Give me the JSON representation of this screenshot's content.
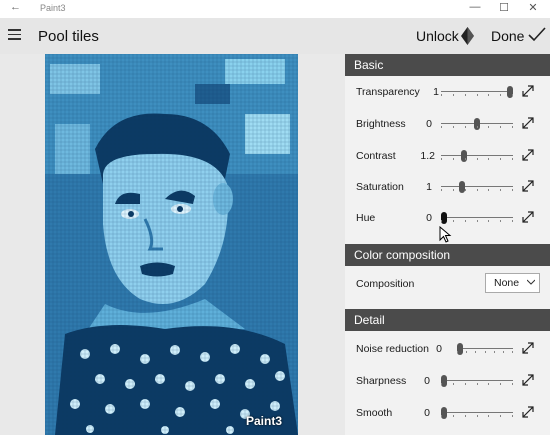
{
  "window": {
    "title": "Paint3",
    "back_glyph": "←",
    "minimize": "—",
    "maximize": "☐",
    "close": "✕"
  },
  "header": {
    "page_title": "Pool tiles",
    "unlock_label": "Unlock",
    "done_label": "Done"
  },
  "canvas": {
    "watermark": "Paint3"
  },
  "panel": {
    "basic": {
      "title": "Basic",
      "rows": [
        {
          "label": "Transparency",
          "value": "1",
          "level": 1.0
        },
        {
          "label": "Brightness",
          "value": "0",
          "level": 0.5
        },
        {
          "label": "Contrast",
          "value": "1.2",
          "level": 0.3
        },
        {
          "label": "Saturation",
          "value": "1",
          "level": 0.27
        },
        {
          "label": "Hue",
          "value": "0",
          "level": 0.0
        }
      ]
    },
    "color_composition": {
      "title": "Color composition",
      "composition_label": "Composition",
      "composition_value": "None"
    },
    "detail": {
      "title": "Detail",
      "rows": [
        {
          "label": "Noise reduction",
          "value": "0",
          "level": 0.0
        },
        {
          "label": "Sharpness",
          "value": "0",
          "level": 0.0
        },
        {
          "label": "Smooth",
          "value": "0",
          "level": 0.0
        }
      ]
    }
  },
  "colors": {
    "header_bg": "#e6e6e6",
    "section_bg": "#4b4b4b",
    "panel_bg": "#f2f2f2",
    "tile_dark": "#0c3a63",
    "tile_light": "#cfeefa"
  },
  "icons": [
    "back-arrow-icon",
    "minimize-icon",
    "maximize-icon",
    "close-icon",
    "hamburger-menu-icon",
    "gem-icon",
    "checkmark-icon",
    "expand-icon",
    "chevron-down-icon",
    "mouse-cursor-icon"
  ]
}
